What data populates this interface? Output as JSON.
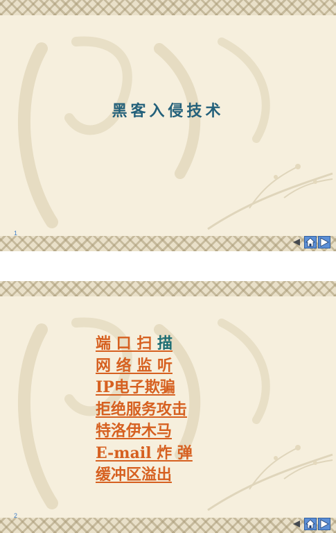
{
  "slide1": {
    "title": "黑客入侵技术",
    "slide_number": "1"
  },
  "slide2": {
    "slide_number": "2",
    "menu": [
      {
        "text": "端 口 扫 ",
        "tail": "描"
      },
      {
        "text": "网 络 监 听",
        "tail": ""
      },
      {
        "text": "IP电子欺骗",
        "tail": ""
      },
      {
        "text": "拒绝服务攻击",
        "tail": ""
      },
      {
        "text": "特洛伊木马",
        "tail": ""
      },
      {
        "text": "E-mail 炸 弹",
        "tail": ""
      },
      {
        "text": "缓冲区溢出",
        "tail": ""
      }
    ]
  },
  "colors": {
    "background": "#f6efdd",
    "title": "#23607a",
    "menu_link": "#d66020",
    "slide_number": "#3c7dc8",
    "nav_button": "#5c8fd6"
  },
  "icons": [
    "prev-arrow-icon",
    "home-icon",
    "next-arrow-icon"
  ]
}
